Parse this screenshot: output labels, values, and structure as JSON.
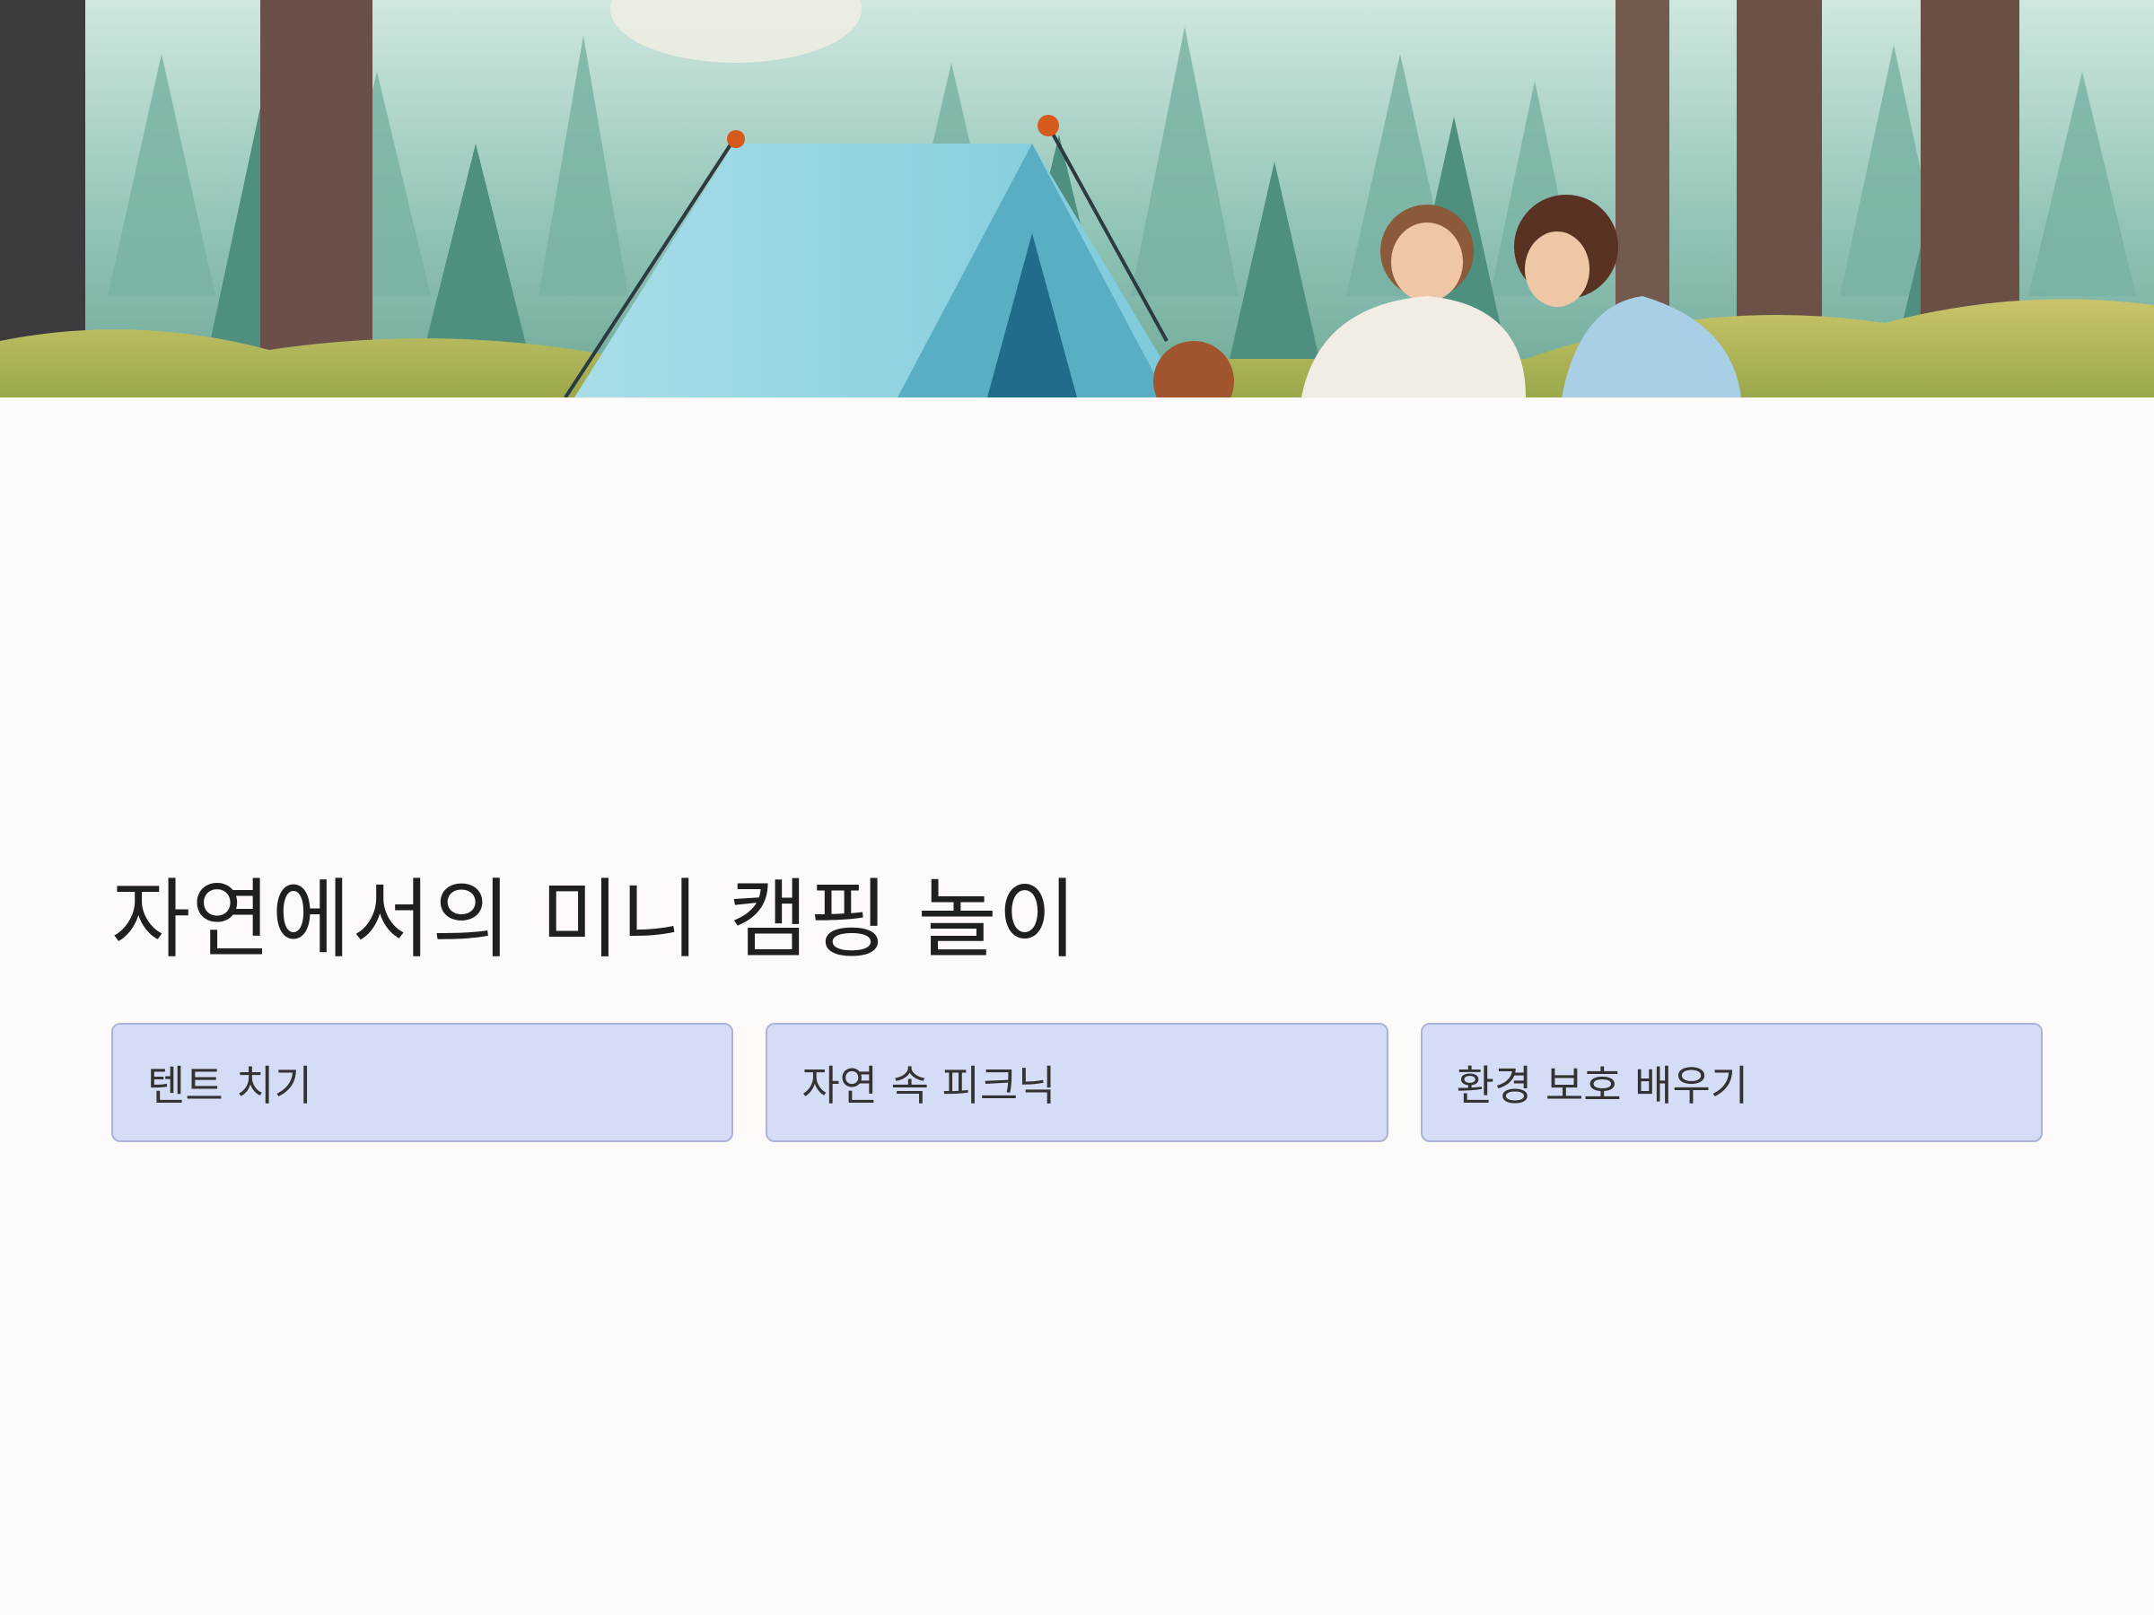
{
  "hero": {
    "image_description_icon": "forest-camping-illustration"
  },
  "slide": {
    "title": "자연에서의 미니 캠핑 놀이",
    "cards": [
      {
        "label": "텐트 치기"
      },
      {
        "label": "자연 속 피크닉"
      },
      {
        "label": "환경 보호 배우기"
      }
    ]
  },
  "colors": {
    "background": "#fffafa",
    "card_fill": "#d5dcf5",
    "card_border": "#aab4d8",
    "title_text": "#1f1f1f",
    "card_text": "#333333"
  }
}
